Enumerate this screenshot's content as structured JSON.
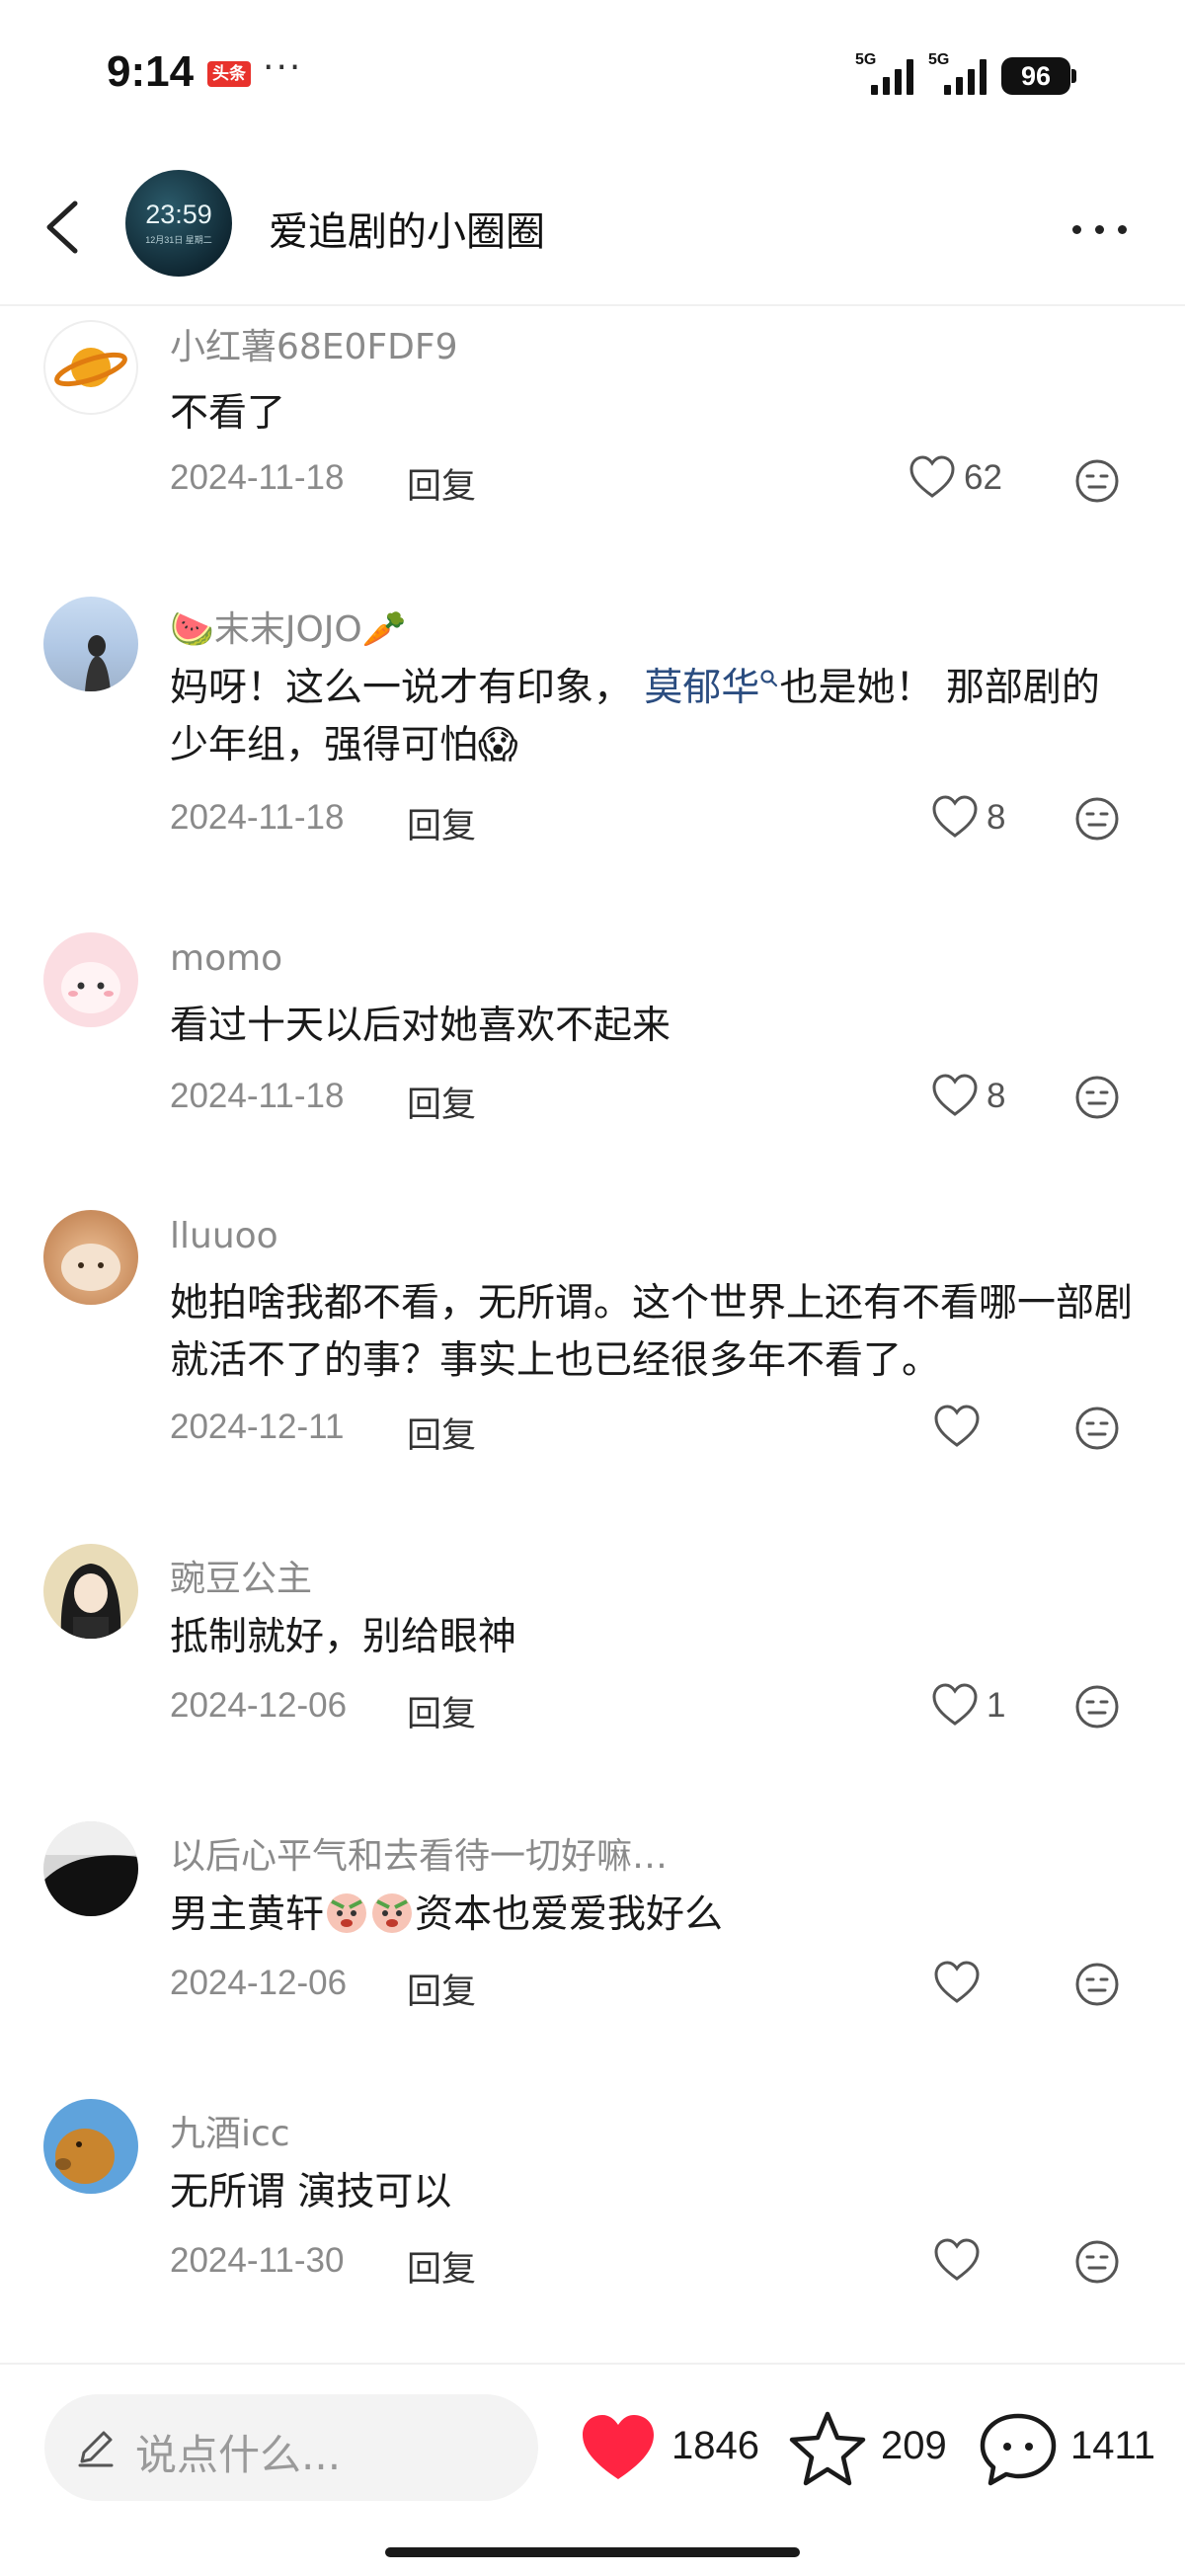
{
  "status_bar": {
    "time": "9:14",
    "news_badge": "头条",
    "dots": "···",
    "signal_1": "5G",
    "signal_2": "5G",
    "battery": "96"
  },
  "header": {
    "avatar_clock": "23:59",
    "avatar_clock_sub": "12月31日 星期二",
    "title": "爱追剧的小圈圈"
  },
  "comments": [
    {
      "name": "小红薯68E0FDF9",
      "text": "不看了",
      "date": "2024-11-18",
      "reply": "回复",
      "likes": "62"
    },
    {
      "name_prefix_emoji": "🍉",
      "name": "末末JOJO",
      "name_suffix_emoji": "🥕",
      "text_before": "妈呀！这么一说才有印象，",
      "mention": "莫郁华",
      "text_after": "也是她！ 那部剧的少年组，强得可怕",
      "text_emoji": "😱",
      "date": "2024-11-18",
      "reply": "回复",
      "likes": "8"
    },
    {
      "name": "momo",
      "text": "看过十天以后对她喜欢不起来",
      "date": "2024-11-18",
      "reply": "回复",
      "likes": "8"
    },
    {
      "name": "lluuoo",
      "text": "她拍啥我都不看，无所谓。这个世界上还有不看哪一部剧就活不了的事？事实上也已经很多年不看了。",
      "date": "2024-12-11",
      "reply": "回复",
      "likes": ""
    },
    {
      "name": "豌豆公主",
      "text": "抵制就好，别给眼神",
      "date": "2024-12-06",
      "reply": "回复",
      "likes": "1"
    },
    {
      "name": "以后心平气和去看待一切好嘛…",
      "text_before": "男主黄轩",
      "text_after": "资本也爱爱我好么",
      "date": "2024-12-06",
      "reply": "回复",
      "likes": ""
    },
    {
      "name": "九酒icc",
      "text": "无所谓 演技可以",
      "date": "2024-11-30",
      "reply": "回复",
      "likes": ""
    }
  ],
  "bottom_bar": {
    "input_placeholder": "说点什么...",
    "like_count": "1846",
    "favorite_count": "209",
    "comment_count": "1411"
  },
  "colors": {
    "accent_red": "#ff2442",
    "mention_blue": "#2b4d80",
    "meta_gray": "#8a8a8a"
  },
  "icons": [
    "back-arrow",
    "more-dots",
    "heart-outline",
    "emoji-face",
    "pen",
    "heart-filled",
    "star-outline",
    "chat-bubble"
  ]
}
